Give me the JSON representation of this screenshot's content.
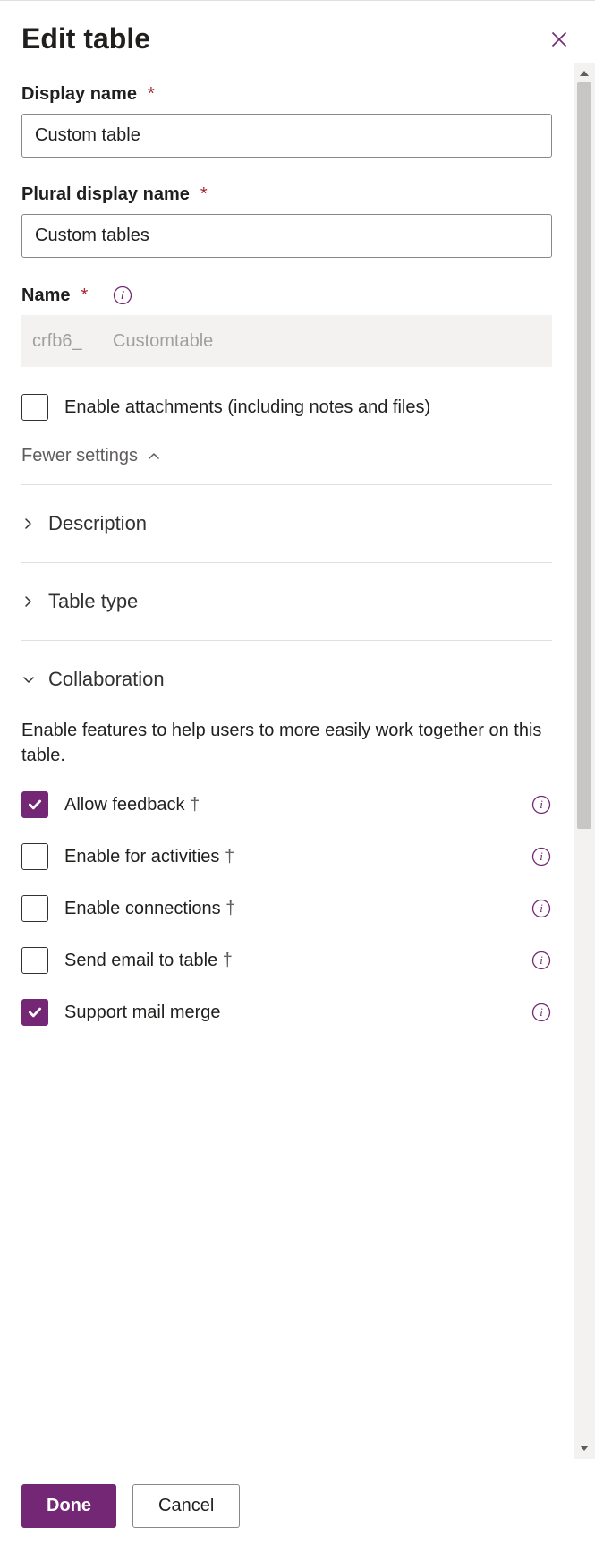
{
  "header": {
    "title": "Edit table"
  },
  "fields": {
    "display_name": {
      "label": "Display name",
      "value": "Custom table"
    },
    "plural_display_name": {
      "label": "Plural display name",
      "value": "Custom tables"
    },
    "name": {
      "label": "Name",
      "prefix": "crfb6_",
      "value": "Customtable"
    },
    "enable_attachments": {
      "label": "Enable attachments (including notes and files)"
    }
  },
  "settings_toggle": "Fewer settings",
  "sections": {
    "description": {
      "title": "Description"
    },
    "table_type": {
      "title": "Table type"
    },
    "collaboration": {
      "title": "Collaboration",
      "description": "Enable features to help users to more easily work together on this table.",
      "items": {
        "allow_feedback": {
          "label": "Allow feedback ",
          "suffix": "†"
        },
        "enable_activities": {
          "label": "Enable for activities ",
          "suffix": "†"
        },
        "enable_connections": {
          "label": "Enable connections ",
          "suffix": "†"
        },
        "send_email": {
          "label": "Send email to table ",
          "suffix": "†"
        },
        "mail_merge": {
          "label": "Support mail merge"
        }
      }
    }
  },
  "footer": {
    "done": "Done",
    "cancel": "Cancel"
  }
}
